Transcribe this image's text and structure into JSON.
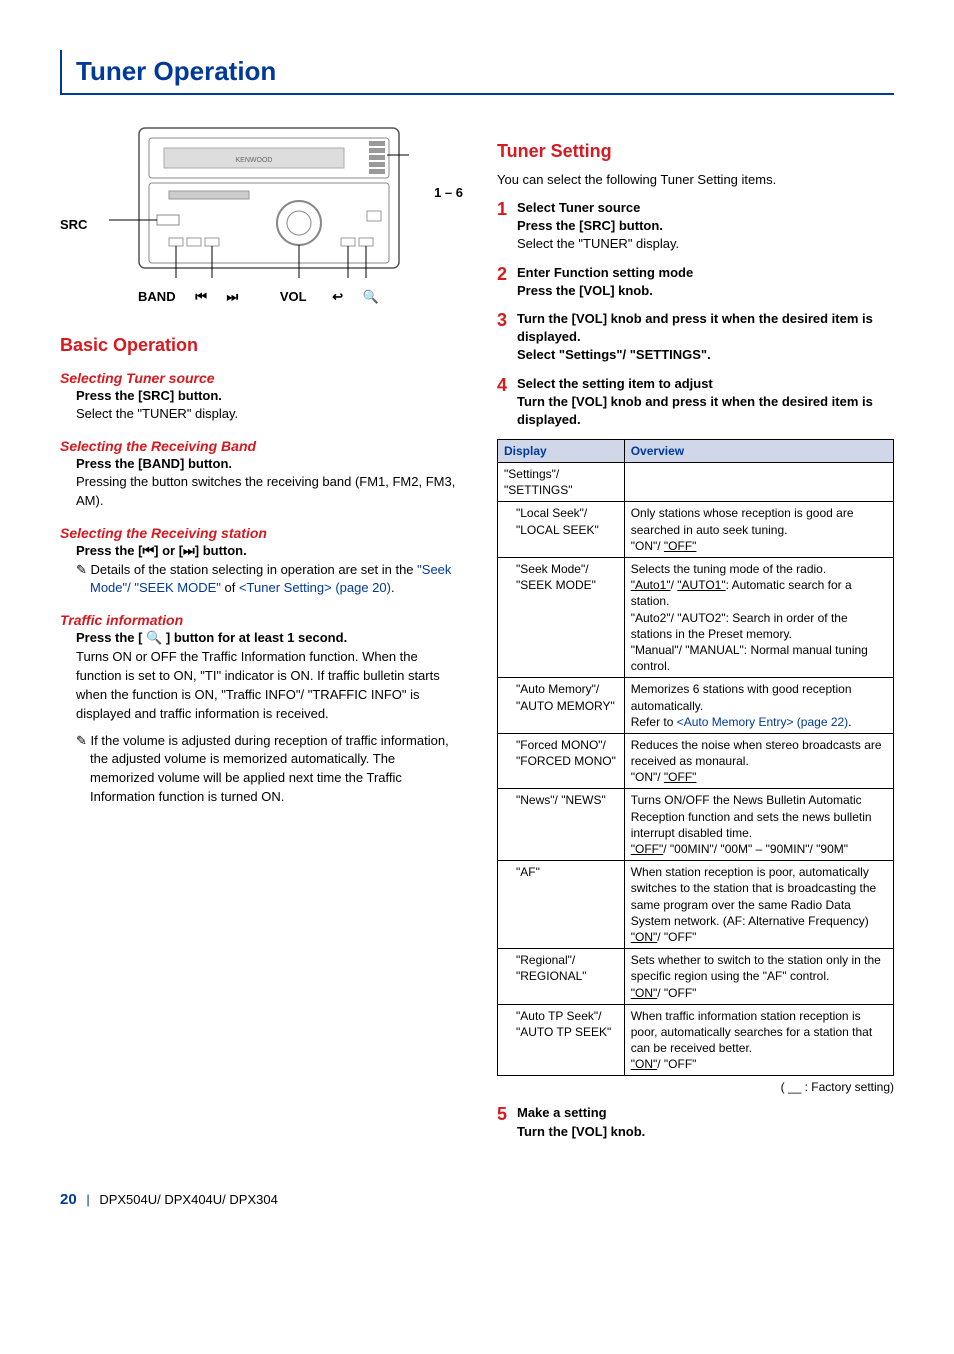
{
  "title": "Tuner Operation",
  "figure": {
    "src_label": "SRC",
    "preset_label": "1 – 6",
    "band_label": "BAND",
    "prev_icon": "⏮◀◀",
    "next_icon": "▶▶⏭",
    "vol_label": "VOL",
    "back_icon": "↩",
    "search_icon": "🔍"
  },
  "left": {
    "section_title": "Basic Operation",
    "s1_title": "Selecting Tuner source",
    "s1_instr": "Press the [SRC] button.",
    "s1_desc": "Select the \"TUNER\" display.",
    "s2_title": "Selecting the Receiving Band",
    "s2_instr": "Press the [BAND] button.",
    "s2_desc": "Pressing the button switches the receiving band (FM1, FM2, FM3, AM).",
    "s3_title": "Selecting the Receiving station",
    "s3_instr": "Press the [⏮] or [⏭] button.",
    "s3_note_a": "Details of the station selecting in operation are set in the ",
    "s3_note_link1": "\"Seek Mode\"/ \"SEEK MODE\"",
    "s3_note_mid": " of ",
    "s3_note_link2": "<Tuner Setting> (page 20)",
    "s3_note_end": ".",
    "s4_title": "Traffic information",
    "s4_instr": "Press the [ 🔍 ] button for at least 1 second.",
    "s4_desc": "Turns ON or OFF the Traffic Information function. When the function is set to ON, \"TI\" indicator is ON. If traffic bulletin starts when the function is ON, \"Traffic INFO\"/ \"TRAFFIC INFO\" is displayed and traffic information is received.",
    "s4_note": "If the volume is adjusted during reception of traffic information, the adjusted volume is memorized automatically. The memorized volume will be applied next time the Traffic Information function is turned ON."
  },
  "right": {
    "section_title": "Tuner Setting",
    "intro": "You can select the following Tuner Setting items.",
    "step1_t": "Select Tuner source",
    "step1_b": "Press the [SRC] button.",
    "step1_d": "Select the \"TUNER\" display.",
    "step2_t": "Enter Function setting mode",
    "step2_b": "Press the [VOL] knob.",
    "step3_t": "Turn the [VOL] knob and press it when the desired item is displayed.",
    "step3_b": "Select \"Settings\"/ \"SETTINGS\".",
    "step4_t": "Select the setting item to adjust",
    "step4_b": "Turn the [VOL] knob and press it when the desired item is displayed.",
    "th_display": "Display",
    "th_overview": "Overview",
    "r0_d": "\"Settings\"/ \"SETTINGS\"",
    "r1_d": "\"Local Seek\"/ \"LOCAL SEEK\"",
    "r1_o_a": "Only stations whose reception is good are searched in auto seek tuning.",
    "r1_o_b": "\"ON\"/ ",
    "r1_o_c": "\"OFF\"",
    "r2_d": "\"Seek Mode\"/ \"SEEK MODE\"",
    "r2_o_a": "Selects the tuning mode of the radio.",
    "r2_o_b": "\"Auto1\"",
    "r2_o_b2": "/ ",
    "r2_o_b3": "\"AUTO1\"",
    "r2_o_b4": ": Automatic search for a station.",
    "r2_o_c": "\"Auto2\"/ \"AUTO2\": Search in order of the stations in the Preset memory.",
    "r2_o_d": "\"Manual\"/ \"MANUAL\": Normal manual tuning control.",
    "r3_d": "\"Auto Memory\"/ \"AUTO MEMORY\"",
    "r3_o_a": "Memorizes 6 stations with good reception automatically.",
    "r3_o_b": "Refer to ",
    "r3_o_link": "<Auto Memory Entry> (page 22)",
    "r3_o_end": ".",
    "r4_d": "\"Forced MONO\"/ \"FORCED MONO\"",
    "r4_o_a": "Reduces the noise when stereo broadcasts are received as monaural.",
    "r4_o_b": "\"ON\"/ ",
    "r4_o_c": "\"OFF\"",
    "r5_d": "\"News\"/ \"NEWS\"",
    "r5_o_a": "Turns ON/OFF the News Bulletin Automatic Reception function and sets the news bulletin interrupt disabled time.",
    "r5_o_b": "\"OFF\"",
    "r5_o_c": "/ \"00MIN\"/ \"00M\" – \"90MIN\"/ \"90M\"",
    "r6_d": "\"AF\"",
    "r6_o_a": "When station reception is poor, automatically switches to the station that is broadcasting the same program over the same Radio Data System network. (AF: Alternative Frequency)",
    "r6_o_b": "\"ON\"",
    "r6_o_c": "/ \"OFF\"",
    "r7_d": "\"Regional\"/ \"REGIONAL\"",
    "r7_o_a": "Sets whether to switch to the station only in the specific region using the \"AF\" control.",
    "r7_o_b": "\"ON\"",
    "r7_o_c": "/ \"OFF\"",
    "r8_d": "\"Auto TP Seek\"/ \"AUTO TP SEEK\"",
    "r8_o_a": "When traffic information station reception is poor, automatically searches for a station that can be received better.",
    "r8_o_b": "\"ON\"",
    "r8_o_c": "/ \"OFF\"",
    "factory_note": "( __ : Factory setting)",
    "step5_t": "Make a setting",
    "step5_b": "Turn the [VOL] knob."
  },
  "footer": {
    "page": "20",
    "models": "DPX504U/ DPX404U/ DPX304"
  }
}
